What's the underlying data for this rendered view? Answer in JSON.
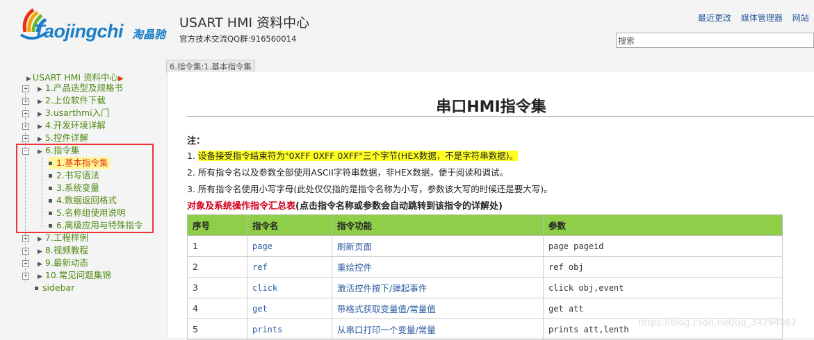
{
  "header": {
    "logo_text": "Taojingchi",
    "logo_cn": "淘晶驰",
    "title": "USART HMI 资料中心",
    "subtitle": "官方技术交流QQ群:916560014",
    "links": [
      "最近更改",
      "媒体管理器",
      "网站"
    ],
    "search_value": "搜索"
  },
  "sidebar": {
    "root": "USART HMI 资料中心",
    "items": [
      {
        "label": "1.产品选型及规格书"
      },
      {
        "label": "2.上位软件下载"
      },
      {
        "label": "3.usarthmi入门"
      },
      {
        "label": "4.开发环境详解"
      },
      {
        "label": "5.控件详解"
      },
      {
        "label": "6.指令集"
      },
      {
        "label": "7.工程样例"
      },
      {
        "label": "8.视频教程"
      },
      {
        "label": "9.最新动态"
      },
      {
        "label": "10.常见问题集锦"
      },
      {
        "label": "sidebar"
      }
    ],
    "subitems": [
      {
        "label": "1.基本指令集"
      },
      {
        "label": "2.书写语法"
      },
      {
        "label": "3.系统变量"
      },
      {
        "label": "4.数据返回格式"
      },
      {
        "label": "5.名称组使用说明"
      },
      {
        "label": "6.高级应用与特殊指令"
      }
    ]
  },
  "tab": "6.指令集:1.基本指令集",
  "content": {
    "title": "串口HMI指令集",
    "note_head": "注：",
    "note1_num": "1.",
    "note1": "设备接受指令结束符为\"0XFF 0XFF 0XFF\"三个字节(HEX数据，不是字符串数据)。",
    "note2": "2. 所有指令名以及参数全部使用ASCII字符串数据，非HEX数据，便于阅读和调试。",
    "note3": "3. 所有指令名使用小写字母(此处仅仅指的是指令名称为小写，参数该大写的时候还是要大写)。",
    "summary_red": "对象及系统操作指令汇总表",
    "summary_black": "(点击指令名称或参数会自动跳转到该指令的详解处)"
  },
  "table": {
    "headers": [
      "序号",
      "指令名",
      "指令功能",
      "参数"
    ],
    "rows": [
      [
        "1",
        "page",
        "刷新页面",
        "page pageid"
      ],
      [
        "2",
        "ref",
        "重绘控件",
        "ref obj"
      ],
      [
        "3",
        "click",
        "激活控件按下/弹起事件",
        "click obj,event"
      ],
      [
        "4",
        "get",
        "带格式获取变量值/常量值",
        "get att"
      ],
      [
        "5",
        "prints",
        "从串口打印一个变量/常量",
        "prints att,lenth"
      ]
    ]
  },
  "watermark": "https://blog.csdn.net/qq_34294087",
  "colors": {
    "accent_green": "#8fce48",
    "link_blue": "#2a5aa0",
    "highlight_yellow": "#ffff22",
    "alert_red": "#d0001c"
  }
}
